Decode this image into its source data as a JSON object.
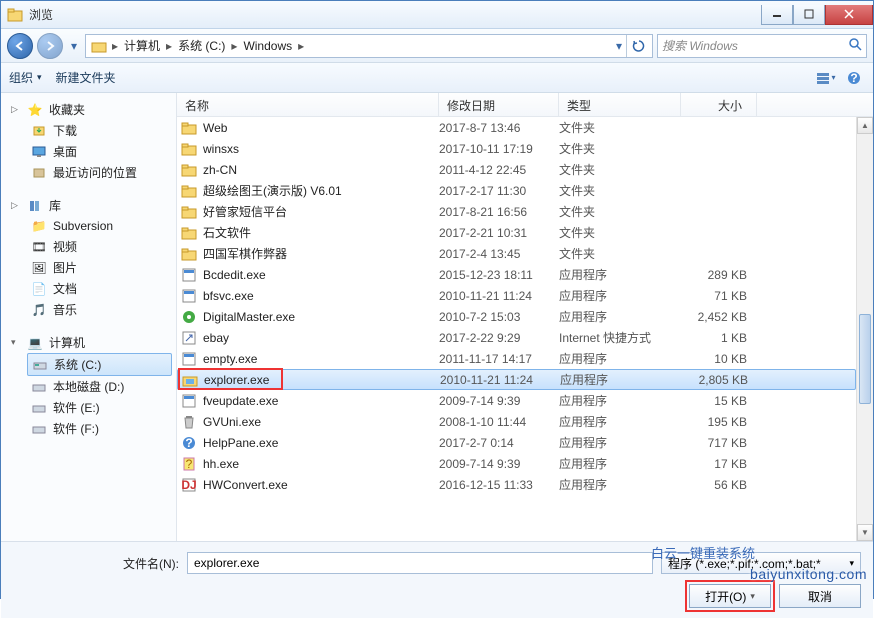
{
  "window": {
    "title": "浏览"
  },
  "nav": {
    "breadcrumb": [
      "计算机",
      "系统 (C:)",
      "Windows"
    ],
    "search_placeholder": "搜索 Windows"
  },
  "toolbar": {
    "organize": "组织",
    "newfolder": "新建文件夹"
  },
  "sidebar": {
    "favorites": {
      "label": "收藏夹",
      "items": [
        "下载",
        "桌面",
        "最近访问的位置"
      ]
    },
    "libraries": {
      "label": "库",
      "items": [
        "Subversion",
        "视频",
        "图片",
        "文档",
        "音乐"
      ]
    },
    "computer": {
      "label": "计算机",
      "items": [
        "系统 (C:)",
        "本地磁盘 (D:)",
        "软件 (E:)",
        "软件 (F:)"
      ]
    }
  },
  "columns": {
    "name": "名称",
    "date": "修改日期",
    "type": "类型",
    "size": "大小"
  },
  "files": [
    {
      "icon": "folder",
      "name": "Web",
      "date": "2017-8-7 13:46",
      "type": "文件夹",
      "size": ""
    },
    {
      "icon": "folder",
      "name": "winsxs",
      "date": "2017-10-11 17:19",
      "type": "文件夹",
      "size": ""
    },
    {
      "icon": "folder",
      "name": "zh-CN",
      "date": "2011-4-12 22:45",
      "type": "文件夹",
      "size": ""
    },
    {
      "icon": "folder",
      "name": "超级绘图王(演示版) V6.01",
      "date": "2017-2-17 11:30",
      "type": "文件夹",
      "size": ""
    },
    {
      "icon": "folder",
      "name": "好管家短信平台",
      "date": "2017-8-21 16:56",
      "type": "文件夹",
      "size": ""
    },
    {
      "icon": "folder",
      "name": "石文软件",
      "date": "2017-2-21 10:31",
      "type": "文件夹",
      "size": ""
    },
    {
      "icon": "folder",
      "name": "四国军棋作弊器",
      "date": "2017-2-4 13:45",
      "type": "文件夹",
      "size": ""
    },
    {
      "icon": "exe",
      "name": "Bcdedit.exe",
      "date": "2015-12-23 18:11",
      "type": "应用程序",
      "size": "289 KB"
    },
    {
      "icon": "exe",
      "name": "bfsvc.exe",
      "date": "2010-11-21 11:24",
      "type": "应用程序",
      "size": "71 KB"
    },
    {
      "icon": "app-green",
      "name": "DigitalMaster.exe",
      "date": "2010-7-2 15:03",
      "type": "应用程序",
      "size": "2,452 KB"
    },
    {
      "icon": "shortcut",
      "name": "ebay",
      "date": "2017-2-22 9:29",
      "type": "Internet 快捷方式",
      "size": "1 KB"
    },
    {
      "icon": "exe",
      "name": "empty.exe",
      "date": "2011-11-17 14:17",
      "type": "应用程序",
      "size": "10 KB"
    },
    {
      "icon": "explorer",
      "name": "explorer.exe",
      "date": "2010-11-21 11:24",
      "type": "应用程序",
      "size": "2,805 KB",
      "selected": true
    },
    {
      "icon": "exe",
      "name": "fveupdate.exe",
      "date": "2009-7-14 9:39",
      "type": "应用程序",
      "size": "15 KB"
    },
    {
      "icon": "trash",
      "name": "GVUni.exe",
      "date": "2008-1-10 11:44",
      "type": "应用程序",
      "size": "195 KB"
    },
    {
      "icon": "help",
      "name": "HelpPane.exe",
      "date": "2017-2-7 0:14",
      "type": "应用程序",
      "size": "717 KB"
    },
    {
      "icon": "chm",
      "name": "hh.exe",
      "date": "2009-7-14 9:39",
      "type": "应用程序",
      "size": "17 KB"
    },
    {
      "icon": "dj",
      "name": "HWConvert.exe",
      "date": "2016-12-15 11:33",
      "type": "应用程序",
      "size": "56 KB"
    }
  ],
  "bottom": {
    "filename_label": "文件名(N):",
    "filename_value": "explorer.exe",
    "filter": "程序 (*.exe;*.pif;*.com;*.bat;*",
    "open": "打开(O)",
    "cancel": "取消"
  },
  "watermark": {
    "line1": "白云一键重装系统",
    "line2": "baiyunxitong.com"
  }
}
